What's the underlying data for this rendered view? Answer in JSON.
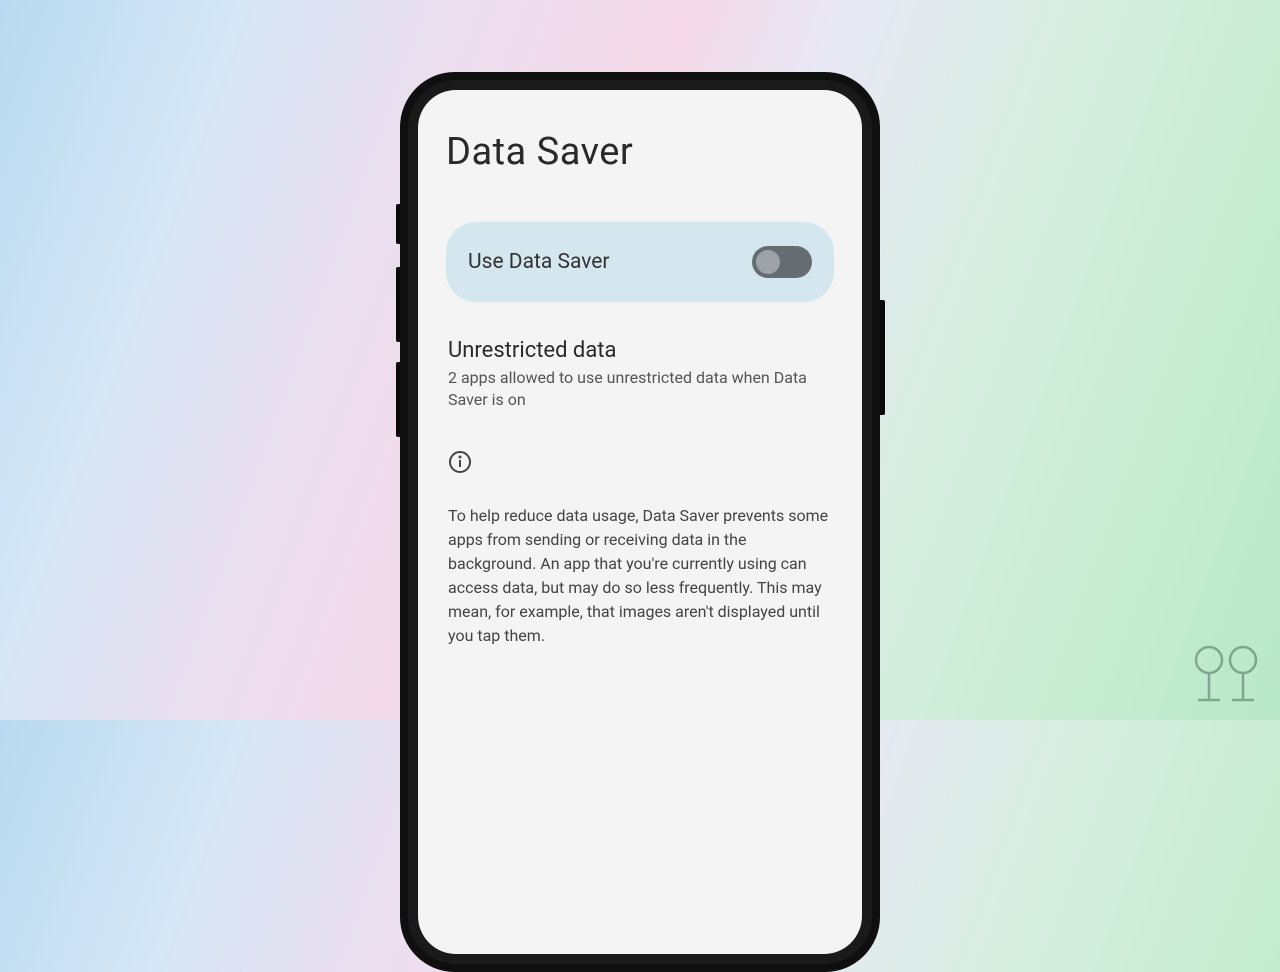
{
  "header": {
    "title": "Data Saver"
  },
  "main": {
    "toggle": {
      "label": "Use Data Saver",
      "state": "off"
    },
    "unrestricted": {
      "title": "Unrestricted data",
      "subtitle": "2 apps allowed to use unrestricted data when Data Saver is on"
    },
    "info": {
      "icon": "info-icon",
      "description": "To help reduce data usage, Data Saver prevents some apps from sending or receiving data in the background. An app that you're currently using can access data, but may do so less frequently. This may mean, for example, that images aren't displayed until you tap them."
    }
  }
}
